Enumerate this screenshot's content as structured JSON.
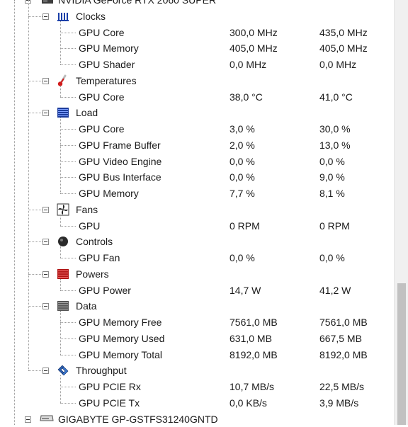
{
  "device": {
    "name": "NVIDIA GeForce RTX 2060 SUPER",
    "icon": "gpu-card-icon"
  },
  "groups": [
    {
      "key": "clocks",
      "label": "Clocks",
      "icon": "clock-bars-icon",
      "rows": [
        {
          "label": "GPU Core",
          "value": "300,0 MHz",
          "max": "435,0 MHz"
        },
        {
          "label": "GPU Memory",
          "value": "405,0 MHz",
          "max": "405,0 MHz"
        },
        {
          "label": "GPU Shader",
          "value": "0,0 MHz",
          "max": "0,0 MHz"
        }
      ]
    },
    {
      "key": "temperatures",
      "label": "Temperatures",
      "icon": "thermometer-icon",
      "rows": [
        {
          "label": "GPU Core",
          "value": "38,0 °C",
          "max": "41,0 °C"
        }
      ]
    },
    {
      "key": "load",
      "label": "Load",
      "icon": "load-bars-icon",
      "rows": [
        {
          "label": "GPU Core",
          "value": "3,0 %",
          "max": "30,0 %"
        },
        {
          "label": "GPU Frame Buffer",
          "value": "2,0 %",
          "max": "13,0 %"
        },
        {
          "label": "GPU Video Engine",
          "value": "0,0 %",
          "max": "0,0 %"
        },
        {
          "label": "GPU Bus Interface",
          "value": "0,0 %",
          "max": "9,0 %"
        },
        {
          "label": "GPU Memory",
          "value": "7,7 %",
          "max": "8,1 %"
        }
      ]
    },
    {
      "key": "fans",
      "label": "Fans",
      "icon": "fan-icon",
      "rows": [
        {
          "label": "GPU",
          "value": "0 RPM",
          "max": "0 RPM"
        }
      ]
    },
    {
      "key": "controls",
      "label": "Controls",
      "icon": "knob-icon",
      "rows": [
        {
          "label": "GPU Fan",
          "value": "0,0 %",
          "max": "0,0 %"
        }
      ]
    },
    {
      "key": "powers",
      "label": "Powers",
      "icon": "power-bars-icon",
      "rows": [
        {
          "label": "GPU Power",
          "value": "14,7 W",
          "max": "41,2 W"
        }
      ]
    },
    {
      "key": "data",
      "label": "Data",
      "icon": "data-stack-icon",
      "rows": [
        {
          "label": "GPU Memory Free",
          "value": "7561,0 MB",
          "max": "7561,0 MB"
        },
        {
          "label": "GPU Memory Used",
          "value": "631,0 MB",
          "max": "667,5 MB"
        },
        {
          "label": "GPU Memory Total",
          "value": "8192,0 MB",
          "max": "8192,0 MB"
        }
      ]
    },
    {
      "key": "throughput",
      "label": "Throughput",
      "icon": "throughput-arrows-icon",
      "rows": [
        {
          "label": "GPU PCIE Rx",
          "value": "10,7 MB/s",
          "max": "22,5 MB/s"
        },
        {
          "label": "GPU PCIE Tx",
          "value": "0,0 KB/s",
          "max": "3,9 MB/s"
        }
      ]
    }
  ],
  "next_device": {
    "name": "GIGABYTE GP-GSTFS31240GNTD",
    "icon": "drive-icon"
  },
  "colors": {
    "tree_line": "#9a9a9a",
    "text": "#1a1a1a",
    "background": "#ffffff",
    "scrollbar_thumb": "#c1c1c1"
  }
}
